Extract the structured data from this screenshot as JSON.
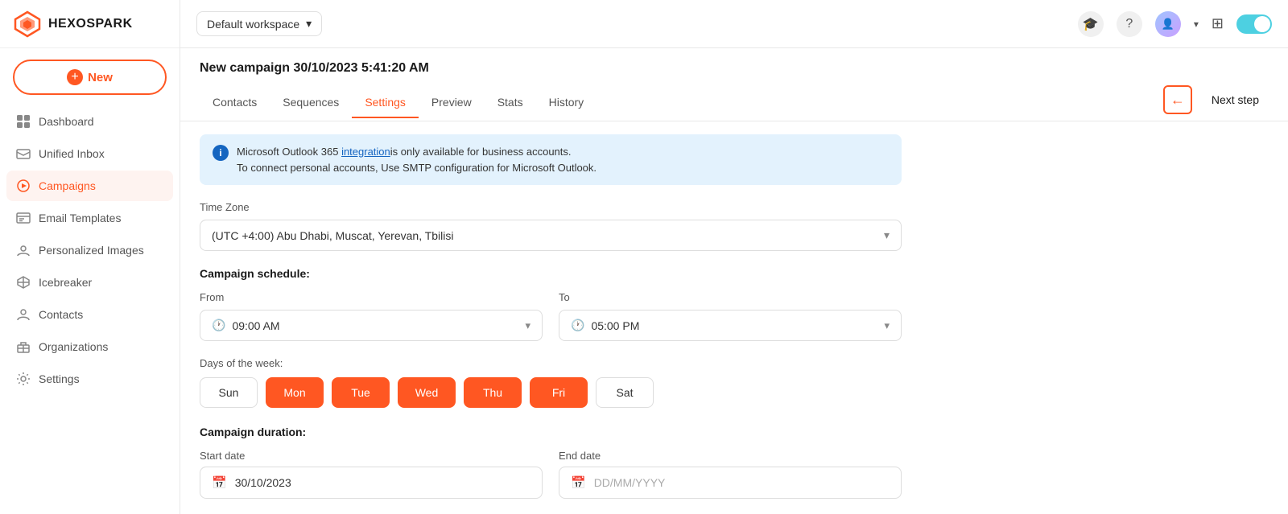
{
  "app": {
    "name": "HEXOSPARK"
  },
  "workspace": {
    "label": "Default workspace"
  },
  "topbar": {
    "help_icon": "?",
    "apps_icon": "⊞",
    "toggle_state": "on"
  },
  "sidebar": {
    "new_button": "New",
    "items": [
      {
        "id": "dashboard",
        "label": "Dashboard",
        "active": false
      },
      {
        "id": "unified-inbox",
        "label": "Unified Inbox",
        "active": false
      },
      {
        "id": "campaigns",
        "label": "Campaigns",
        "active": true
      },
      {
        "id": "email-templates",
        "label": "Email Templates",
        "active": false
      },
      {
        "id": "personalized-images",
        "label": "Personalized Images",
        "active": false
      },
      {
        "id": "icebreaker",
        "label": "Icebreaker",
        "active": false
      },
      {
        "id": "contacts",
        "label": "Contacts",
        "active": false
      },
      {
        "id": "organizations",
        "label": "Organizations",
        "active": false
      },
      {
        "id": "settings",
        "label": "Settings",
        "active": false
      }
    ]
  },
  "campaign": {
    "title": "New campaign 30/10/2023 5:41:20 AM",
    "tabs": [
      {
        "id": "contacts",
        "label": "Contacts"
      },
      {
        "id": "sequences",
        "label": "Sequences"
      },
      {
        "id": "settings",
        "label": "Settings",
        "active": true
      },
      {
        "id": "preview",
        "label": "Preview"
      },
      {
        "id": "stats",
        "label": "Stats"
      },
      {
        "id": "history",
        "label": "History"
      }
    ],
    "back_btn": "←",
    "next_step": "Next step"
  },
  "settings": {
    "info_line1": "Microsoft Outlook 365",
    "info_link": "integration",
    "info_line1_suffix": "is only available for business accounts.",
    "info_line2": "To connect personal accounts, Use SMTP configuration for Microsoft Outlook.",
    "timezone_label": "Time Zone",
    "timezone_value": "(UTC +4:00) Abu Dhabi, Muscat, Yerevan, Tbilisi",
    "schedule_label": "Campaign schedule:",
    "from_label": "From",
    "from_value": "09:00 AM",
    "to_label": "To",
    "to_value": "05:00 PM",
    "days_label": "Days of the week:",
    "days": [
      {
        "id": "sun",
        "label": "Sun",
        "active": false
      },
      {
        "id": "mon",
        "label": "Mon",
        "active": true
      },
      {
        "id": "tue",
        "label": "Tue",
        "active": true
      },
      {
        "id": "wed",
        "label": "Wed",
        "active": true
      },
      {
        "id": "thu",
        "label": "Thu",
        "active": true
      },
      {
        "id": "fri",
        "label": "Fri",
        "active": true
      },
      {
        "id": "sat",
        "label": "Sat",
        "active": false
      }
    ],
    "duration_label": "Campaign duration:",
    "start_date_label": "Start date",
    "start_date_value": "30/10/2023",
    "end_date_label": "End date",
    "end_date_placeholder": "DD/MM/YYYY"
  }
}
